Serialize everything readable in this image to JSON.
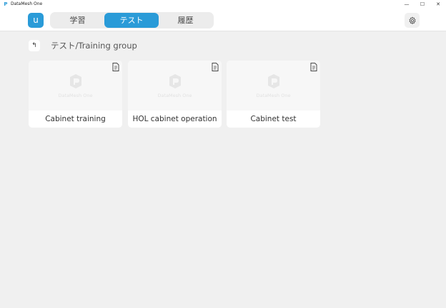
{
  "window": {
    "title": "DataMesh One",
    "icon": "datamesh-app-icon",
    "controls": {
      "minimize": "—",
      "maximize": "☐",
      "close": "✕"
    }
  },
  "header": {
    "avatar_letter": "u",
    "tabs": [
      {
        "label": "学習",
        "active": false
      },
      {
        "label": "テスト",
        "active": true
      },
      {
        "label": "履歴",
        "active": false
      }
    ],
    "settings_icon": "gear-icon"
  },
  "breadcrumb": {
    "back_icon": "↰",
    "path": "テスト/Training group"
  },
  "cards": [
    {
      "title": "Cabinet training",
      "thumb_text": "DataMesh One",
      "icon": "document-icon"
    },
    {
      "title": "HOL cabinet operation",
      "thumb_text": "DataMesh One",
      "icon": "document-icon"
    },
    {
      "title": "Cabinet test",
      "thumb_text": "DataMesh One",
      "icon": "document-icon"
    }
  ],
  "colors": {
    "accent": "#2a9bd8",
    "background": "#f0f0f0",
    "card": "#ffffff"
  }
}
